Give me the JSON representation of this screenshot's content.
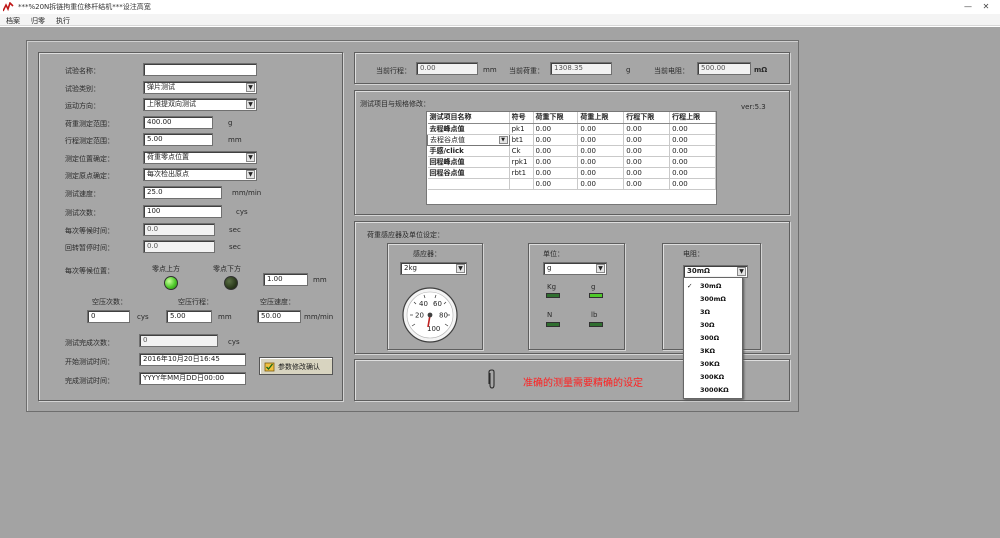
{
  "window": {
    "title": "***%20N拆链拘重位移杆结机***设注高宽",
    "min_glyph": "—",
    "close_glyph": "✕"
  },
  "menu": [
    "档案",
    "归零",
    "执行"
  ],
  "left": {
    "rows": [
      {
        "label": "试验名称：",
        "value": "",
        "kind": "text"
      },
      {
        "label": "试验类别：",
        "value": "弹片测试",
        "kind": "combo"
      },
      {
        "label": "运动方向：",
        "value": "上限提双向测试",
        "kind": "combo"
      },
      {
        "label": "荷重测定范围：",
        "value": "400.00",
        "kind": "text",
        "unit": "g"
      },
      {
        "label": "行程测定范围：",
        "value": "5.00",
        "kind": "text",
        "unit": "mm"
      },
      {
        "label": "测定位置确定：",
        "value": "荷重零点位置",
        "kind": "combo"
      },
      {
        "label": "测定原点确定：",
        "value": "每次检出原点",
        "kind": "combo"
      },
      {
        "label": "测试速度：",
        "value": "25.0",
        "kind": "text",
        "unit": "mm/min"
      },
      {
        "label": "测试次数：",
        "value": "100",
        "kind": "text",
        "unit": "cys"
      },
      {
        "label": "每次等候时间：",
        "value": "0.0",
        "kind": "ro",
        "unit": "sec"
      },
      {
        "label": "回转暂停时间：",
        "value": "0.0",
        "kind": "ro",
        "unit": "sec"
      }
    ],
    "wait_position_label": "每次等候位置：",
    "zero_above": "零点上方",
    "zero_below": "零点下方",
    "wait_distance": "1.00",
    "wait_distance_unit": "mm",
    "idle": {
      "count_label": "空压次数：",
      "count_value": "0",
      "count_unit": "cys",
      "stroke_label": "空压行程：",
      "stroke_value": "5.00",
      "stroke_unit": "mm",
      "speed_label": "空压速度：",
      "speed_value": "50.00",
      "speed_unit": "mm/min"
    },
    "done_label": "测试完成次数：",
    "done_value": "0",
    "done_unit": "cys",
    "start_label": "开始测试时间：",
    "start_value": "2016年10月20日16:45",
    "end_label": "完成测试时间：",
    "end_value": "YYYY年MM月DD日00:00",
    "confirm_button": "参数修改确认"
  },
  "status": {
    "stroke_label": "当前行程：",
    "stroke_value": "0.00",
    "stroke_unit": "mm",
    "load_label": "当前荷重：",
    "load_value": "1308.35",
    "load_unit": "g",
    "res_label": "当前电阻：",
    "res_value": "500.00",
    "res_unit": "mΩ"
  },
  "spec": {
    "title": "测试项目与规格修改：",
    "version": "ver:5.3",
    "headers": [
      "测试项目名称",
      "符号",
      "荷重下限",
      "荷重上限",
      "行程下限",
      "行程上限"
    ],
    "rows": [
      [
        "去程峰点值",
        "pk1",
        "0.00",
        "0.00",
        "0.00",
        "0.00"
      ],
      [
        "去程谷点值",
        "bt1",
        "0.00",
        "0.00",
        "0.00",
        "0.00"
      ],
      [
        "手感/click",
        "Ck",
        "0.00",
        "0.00",
        "0.00",
        "0.00"
      ],
      [
        "回程峰点值",
        "rpk1",
        "0.00",
        "0.00",
        "0.00",
        "0.00"
      ],
      [
        "回程谷点值",
        "rbt1",
        "0.00",
        "0.00",
        "0.00",
        "0.00"
      ],
      [
        "",
        "",
        "0.00",
        "0.00",
        "0.00",
        "0.00"
      ]
    ]
  },
  "ranges": {
    "title": "荷重感应器及单位设定：",
    "sensor_label": "感应器：",
    "sensor_value": "2kg",
    "gauge_ticks": [
      "20",
      "40",
      "60",
      "80",
      "100"
    ],
    "unit_label": "单位：",
    "unit_value": "g",
    "unit_leds": [
      {
        "label": "Kg",
        "color": "#2f6e2f"
      },
      {
        "label": "g",
        "color": "#4ec92a"
      },
      {
        "label": "N",
        "color": "#2f6e2f"
      },
      {
        "label": "lb",
        "color": "#2f6e2f"
      }
    ],
    "res_label": "电阻：",
    "res_value": "30mΩ",
    "res_options": [
      "30mΩ",
      "300mΩ",
      "3Ω",
      "30Ω",
      "300Ω",
      "3KΩ",
      "30KΩ",
      "300KΩ",
      "3000KΩ"
    ],
    "res_checked_index": 0,
    "check_glyph": "✓"
  },
  "banner": {
    "text": "准确的测量需要精确的设定",
    "color": "#ff2020"
  },
  "colors": {
    "led_on": "#4ec92a",
    "led_off": "#2c3b1d"
  }
}
